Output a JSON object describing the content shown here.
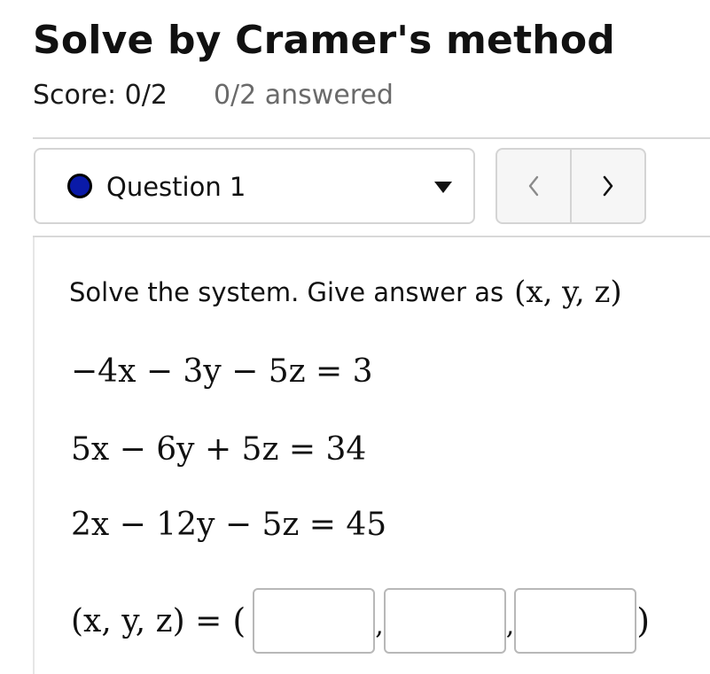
{
  "header": {
    "title": "Solve by Cramer's method",
    "score": "Score: 0/2",
    "answered": "0/2 answered"
  },
  "question_selector": {
    "label": "Question 1",
    "status_color": "#0a1aa8",
    "icon": "caret-down-icon"
  },
  "nav": {
    "prev_icon": "chevron-left-icon",
    "next_icon": "chevron-right-icon"
  },
  "question": {
    "prompt": "Solve the system. Give answer as",
    "prompt_tuple": "(x, y, z)",
    "equations": [
      "−4x − 3y − 5z = 3",
      "5x − 6y + 5z = 34",
      "2x − 12y − 5z = 45"
    ],
    "answer_lhs": "(x, y, z) =",
    "answer_values": [
      "",
      "",
      ""
    ]
  }
}
